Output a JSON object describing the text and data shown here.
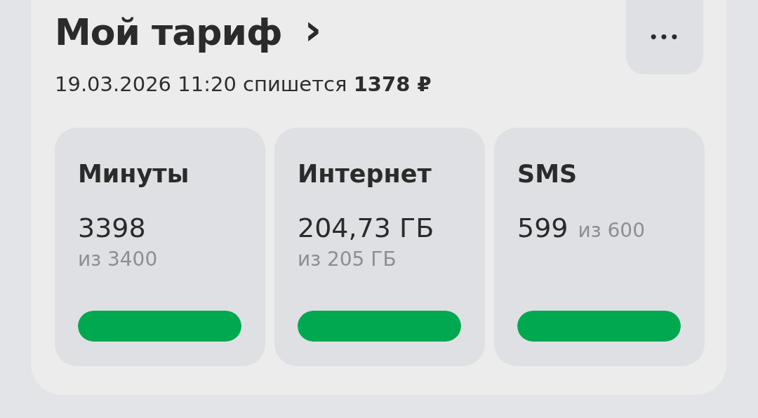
{
  "header": {
    "title": "Мой тариф",
    "chevron": "›"
  },
  "more_button": {
    "label": "•••"
  },
  "charge_line": "19.03.2026 11:20 спишется **1378 ₽**",
  "counters": [
    {
      "kind": "stacked",
      "name": "Минуты",
      "value": "3398",
      "limit": "из 3400",
      "level": 1
    },
    {
      "kind": "stacked",
      "name": "Интернет",
      "value": "204,73 ГБ",
      "limit": "из 205 ГБ",
      "level": 1
    },
    {
      "kind": "inline",
      "name": "SMS",
      "value": "599",
      "limit": "из 600",
      "level": 1
    }
  ]
}
